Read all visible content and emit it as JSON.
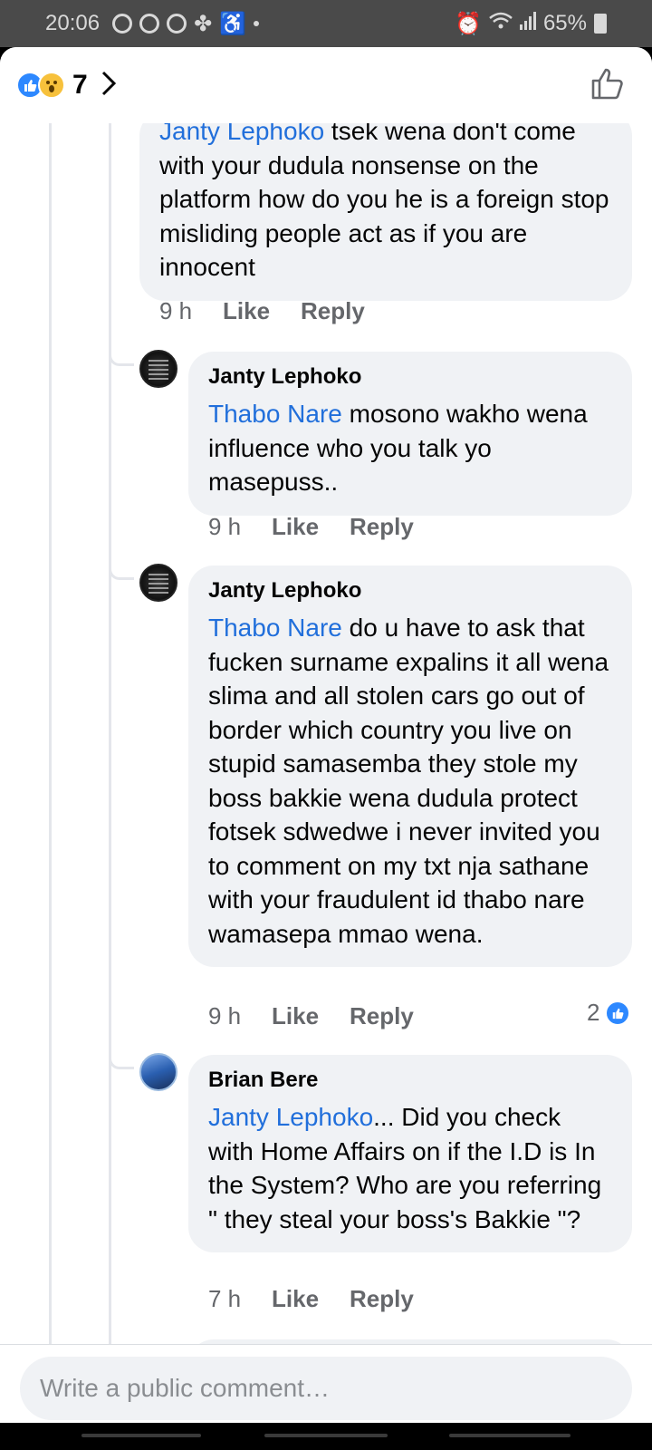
{
  "status_bar": {
    "time": "20:06",
    "battery": "65%"
  },
  "header": {
    "reaction_count": "7",
    "icons": [
      "like-reaction-icon",
      "wow-reaction-icon",
      "chevron-right-icon",
      "thumbs-up-outline-icon"
    ]
  },
  "comments": [
    {
      "author": "",
      "mention": "Janty Lephoko",
      "text": " tsek wena don't come with your dudula nonsense on the platform how do you he is a foreign stop misliding people act as if you are innocent",
      "time": "9 h",
      "like": "Like",
      "reply": "Reply"
    },
    {
      "author": "Janty Lephoko",
      "mention": "Thabo Nare",
      "text": " mosono wakho wena influence who you talk yo masepuss..",
      "time": "9 h",
      "like": "Like",
      "reply": "Reply"
    },
    {
      "author": "Janty Lephoko",
      "mention": "Thabo Nare",
      "text": " do u have to ask that fucken surname expalins it all wena slima and all stolen cars go out of border which country you live on stupid samasemba they stole my boss bakkie wena dudula protect fotsek sdwedwe i never invited you to comment on my txt nja sathane with your fraudulent id thabo nare wamasepa mmao wena.",
      "time": "9 h",
      "like": "Like",
      "reply": "Reply",
      "reaction_count": "2"
    },
    {
      "author": "Brian Bere",
      "mention": "Janty Lephoko",
      "text": "... Did you check with Home Affairs on if the I.D is In the System? Who are you referring \" they steal your boss's Bakkie \"?",
      "time": "7 h",
      "like": "Like",
      "reply": "Reply"
    }
  ],
  "composer": {
    "placeholder": "Write a public comment…"
  },
  "colors": {
    "mention": "#216fdb",
    "bubble": "#f0f2f5",
    "like_blue": "#2d88ff"
  }
}
